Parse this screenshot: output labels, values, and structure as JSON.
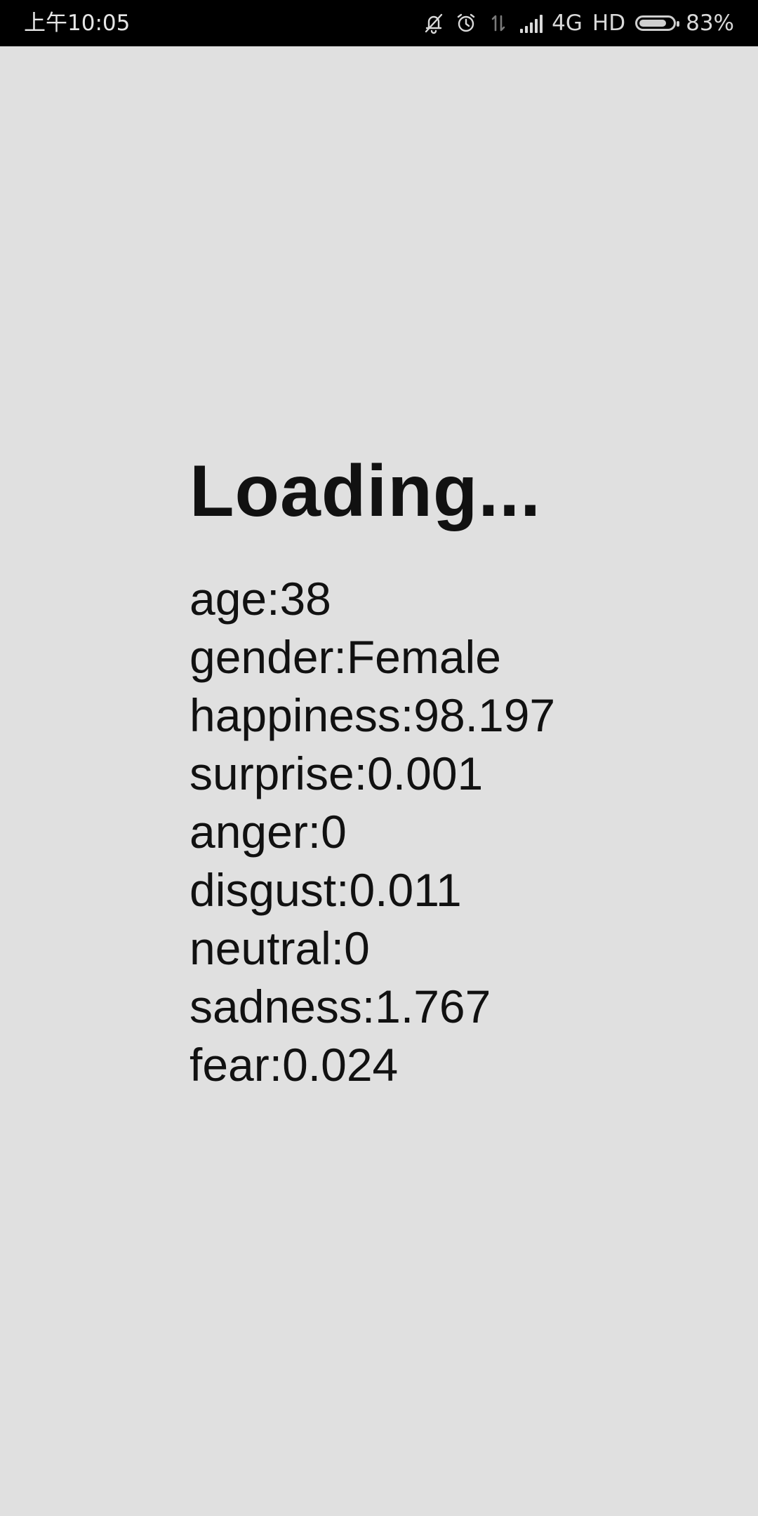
{
  "status_bar": {
    "time": "上午10:05",
    "network": "4G",
    "hd": "HD",
    "battery_percent": "83%",
    "battery_level": 0.83,
    "icons": [
      "bell-off-icon",
      "alarm-icon",
      "data-transfer-icon",
      "signal-icon",
      "battery-icon"
    ]
  },
  "main": {
    "title": "Loading...",
    "stats": [
      "age:38",
      "gender:Female",
      "happiness:98.197",
      "surprise:0.001",
      "anger:0",
      "disgust:0.011",
      "neutral:0",
      "sadness:1.767",
      "fear:0.024"
    ]
  },
  "colors": {
    "background": "#e0e0e0",
    "status_bar": "#000000",
    "text": "#111111"
  }
}
